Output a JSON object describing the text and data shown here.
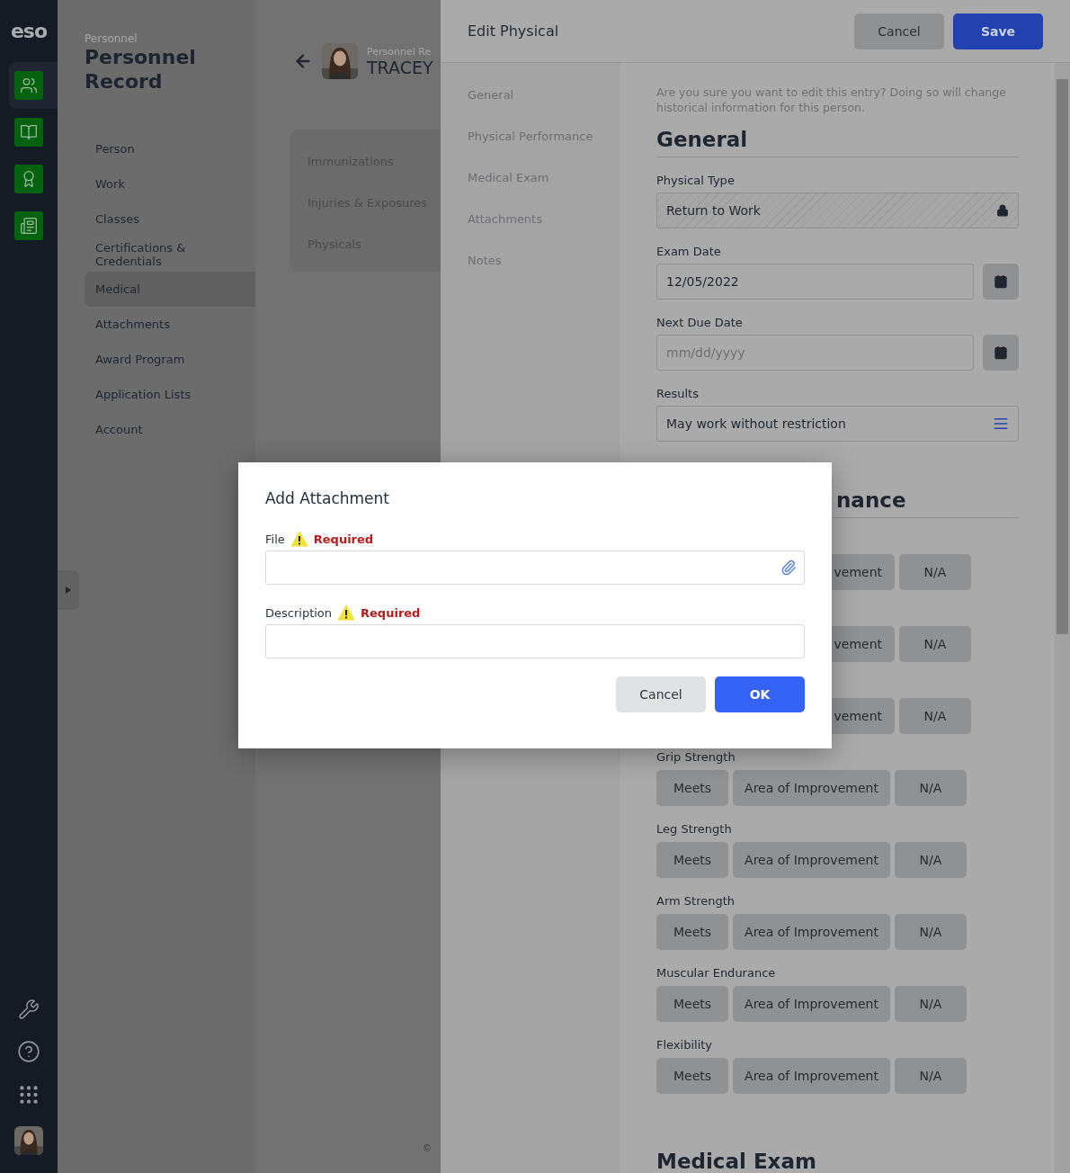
{
  "app_sidebar": {
    "logo": "eso",
    "nav": [
      {
        "selected": true
      },
      {
        "selected": false
      },
      {
        "selected": false
      },
      {
        "selected": false
      }
    ]
  },
  "personnel": {
    "breadcrumb": "Personnel",
    "title": "Personnel Record",
    "menu": [
      {
        "label": "Person",
        "selected": false
      },
      {
        "label": "Work",
        "selected": false
      },
      {
        "label": "Classes",
        "selected": false
      },
      {
        "label": "Certifications & Credentials",
        "selected": false
      },
      {
        "label": "Medical",
        "selected": true
      },
      {
        "label": "Attachments",
        "selected": false
      },
      {
        "label": "Award Program",
        "selected": false
      },
      {
        "label": "Application Lists",
        "selected": false
      },
      {
        "label": "Account",
        "selected": false
      }
    ]
  },
  "record": {
    "subtitle": "Personnel Re",
    "name": "TRACEY",
    "tabs": [
      "Immunizations",
      "Injuries & Exposures",
      "Physicals"
    ],
    "footer": "©"
  },
  "drawer": {
    "title": "Edit Physical",
    "cancel": "Cancel",
    "save": "Save",
    "nav": [
      "General",
      "Physical Performance",
      "Medical Exam",
      "Attachments",
      "Notes"
    ],
    "warning": "Are you sure you want to edit this entry? Doing so will change historical information for this person.",
    "general": {
      "heading": "General",
      "fields": [
        {
          "kind": "locked",
          "label": "Physical Type",
          "value": "Return to Work"
        },
        {
          "kind": "date",
          "label": "Exam Date",
          "value": "12/05/2022"
        },
        {
          "kind": "date",
          "label": "Next Due Date",
          "placeholder": "mm/dd/yyyy"
        },
        {
          "kind": "list",
          "label": "Results",
          "value": "May work without restriction"
        }
      ]
    },
    "performance": {
      "heading": "nance",
      "covered": true,
      "rows": [
        {
          "covered": true,
          "options": [
            "vement",
            "N/A"
          ]
        },
        {
          "covered": true,
          "options": [
            "vement",
            "N/A"
          ]
        },
        {
          "covered": true,
          "options": [
            "vement",
            "N/A"
          ]
        },
        {
          "covered": false,
          "label": "Grip Strength",
          "options": [
            "Meets",
            "Area of Improvement",
            "N/A"
          ]
        },
        {
          "covered": false,
          "label": "Leg Strength",
          "options": [
            "Meets",
            "Area of Improvement",
            "N/A"
          ]
        },
        {
          "covered": false,
          "label": "Arm Strength",
          "options": [
            "Meets",
            "Area of Improvement",
            "N/A"
          ]
        },
        {
          "covered": false,
          "label": "Muscular Endurance",
          "options": [
            "Meets",
            "Area of Improvement",
            "N/A"
          ]
        },
        {
          "covered": false,
          "label": "Flexibility",
          "options": [
            "Meets",
            "Area of Improvement",
            "N/A"
          ]
        }
      ]
    },
    "next_heading": "Medical Exam"
  },
  "modal": {
    "title": "Add Attachment",
    "fields": [
      {
        "kind": "file",
        "label": "File",
        "required": "Required"
      },
      {
        "kind": "text",
        "label": "Description",
        "required": "Required"
      }
    ],
    "cancel": "Cancel",
    "ok": "OK"
  }
}
